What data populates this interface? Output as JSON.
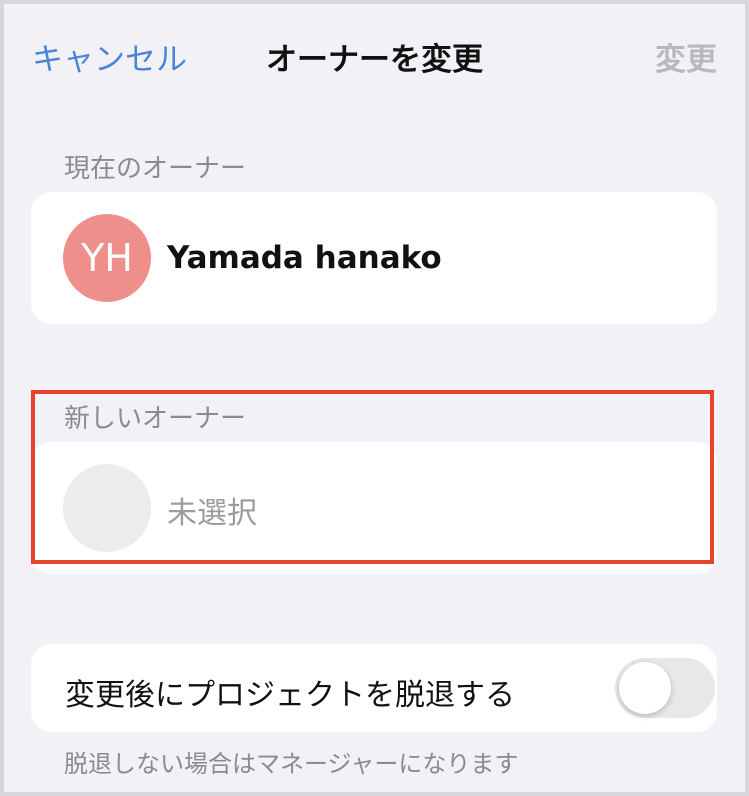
{
  "nav": {
    "cancel_label": "キャンセル",
    "title": "オーナーを変更",
    "confirm_label": "変更"
  },
  "current_owner": {
    "section_label": "現在のオーナー",
    "initials": "YH",
    "name": "Yamada hanako",
    "avatar_color": "#ef8f8c"
  },
  "new_owner": {
    "section_label": "新しいオーナー",
    "placeholder": "未選択"
  },
  "leave_option": {
    "label": "変更後にプロジェクトを脱退する",
    "enabled": false
  },
  "footnote": "脱退しない場合はマネージャーになります",
  "colors": {
    "accent": "#4a84d8",
    "disabled": "#b9b9bd",
    "highlight": "#e8432c"
  }
}
